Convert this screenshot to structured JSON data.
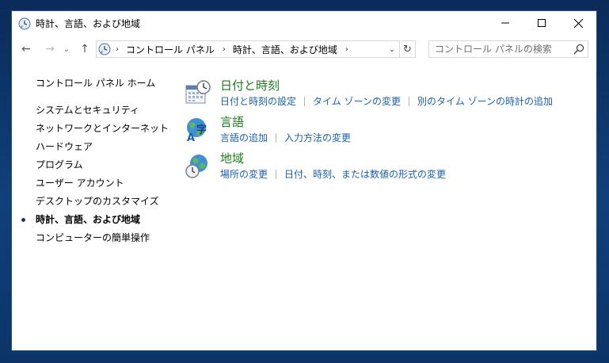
{
  "window": {
    "title": "時計、言語、および地域"
  },
  "titlebar": {
    "minimize_icon": "minimize-icon",
    "maximize_icon": "maximize-icon",
    "close_icon": "close-icon"
  },
  "nav": {
    "back_icon": "←",
    "forward_icon": "→",
    "recent_icon": "⌄",
    "up_icon": "↑"
  },
  "address": {
    "crumbs": [
      "コントロール パネル",
      "時計、言語、および地域"
    ],
    "dropdown_icon": "⌄",
    "refresh_icon": "↻"
  },
  "search": {
    "placeholder": "コントロール パネルの検索"
  },
  "sidebar": {
    "home": "コントロール パネル ホーム",
    "items": [
      {
        "label": "システムとセキュリティ",
        "current": false
      },
      {
        "label": "ネットワークとインターネット",
        "current": false
      },
      {
        "label": "ハードウェア",
        "current": false
      },
      {
        "label": "プログラム",
        "current": false
      },
      {
        "label": "ユーザー アカウント",
        "current": false
      },
      {
        "label": "デスクトップのカスタマイズ",
        "current": false
      },
      {
        "label": "時計、言語、および地域",
        "current": true
      },
      {
        "label": "コンピューターの簡単操作",
        "current": false
      }
    ]
  },
  "categories": [
    {
      "title": "日付と時刻",
      "icon": "datetime-icon",
      "links": [
        "日付と時刻の設定",
        "タイム ゾーンの変更",
        "別のタイム ゾーンの時計の追加"
      ]
    },
    {
      "title": "言語",
      "icon": "language-icon",
      "links": [
        "言語の追加",
        "入力方法の変更"
      ]
    },
    {
      "title": "地域",
      "icon": "region-icon",
      "links": [
        "場所の変更",
        "日付、時刻、または数値の形式の変更"
      ]
    }
  ],
  "colors": {
    "category_title": "#1e7b1e",
    "link": "#1a5fb4",
    "bullet": "#1e3a5f"
  }
}
